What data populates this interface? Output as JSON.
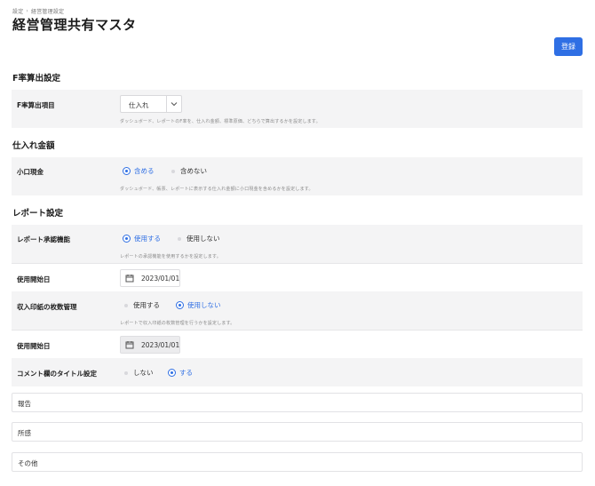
{
  "breadcrumb": {
    "root": "設定",
    "current": "経営管理設定"
  },
  "page_title": "経営管理共有マスタ",
  "register_button": "登録",
  "sections": {
    "f_rate": {
      "title": "F率算出設定",
      "item_label": "F率算出項目",
      "select_value": "仕入れ",
      "desc": "ダッシュボード、レポートのF率を、仕入れ金額、標準原価、どちらで算出するかを設定します。"
    },
    "purchase": {
      "title": "仕入れ金額",
      "item_label": "小口現金",
      "option_include": "含める",
      "option_exclude": "含めない",
      "selected": "include",
      "desc": "ダッシュボード、帳票、レポートに表示する仕入れ金額に小口現金を含めるかを設定します。"
    },
    "report": {
      "title": "レポート設定",
      "approval_label": "レポート承認機能",
      "approval_use": "使用する",
      "approval_nouse": "使用しない",
      "approval_selected": "use",
      "approval_desc": "レポートの承認機能を使用するかを設定します。",
      "start_date_label_1": "使用開始日",
      "start_date_1": "2023/01/01",
      "stamp_label": "収入印紙の枚数管理",
      "stamp_use": "使用する",
      "stamp_nouse": "使用しない",
      "stamp_selected": "nouse",
      "stamp_desc": "レポートで収入印紙の枚数管理を行うかを設定します。",
      "start_date_label_2": "使用開始日",
      "start_date_2": "2023/01/01",
      "comment_label": "コメント欄のタイトル設定",
      "comment_no": "しない",
      "comment_yes": "する",
      "comment_selected": "yes",
      "comment_titles": [
        "報告",
        "所感",
        "その他"
      ]
    }
  },
  "colors": {
    "accent": "#2f6fe4",
    "row_bg": "#f4f4f5"
  },
  "icons": {
    "select": "chevron-down-icon",
    "date": "calendar-icon"
  }
}
